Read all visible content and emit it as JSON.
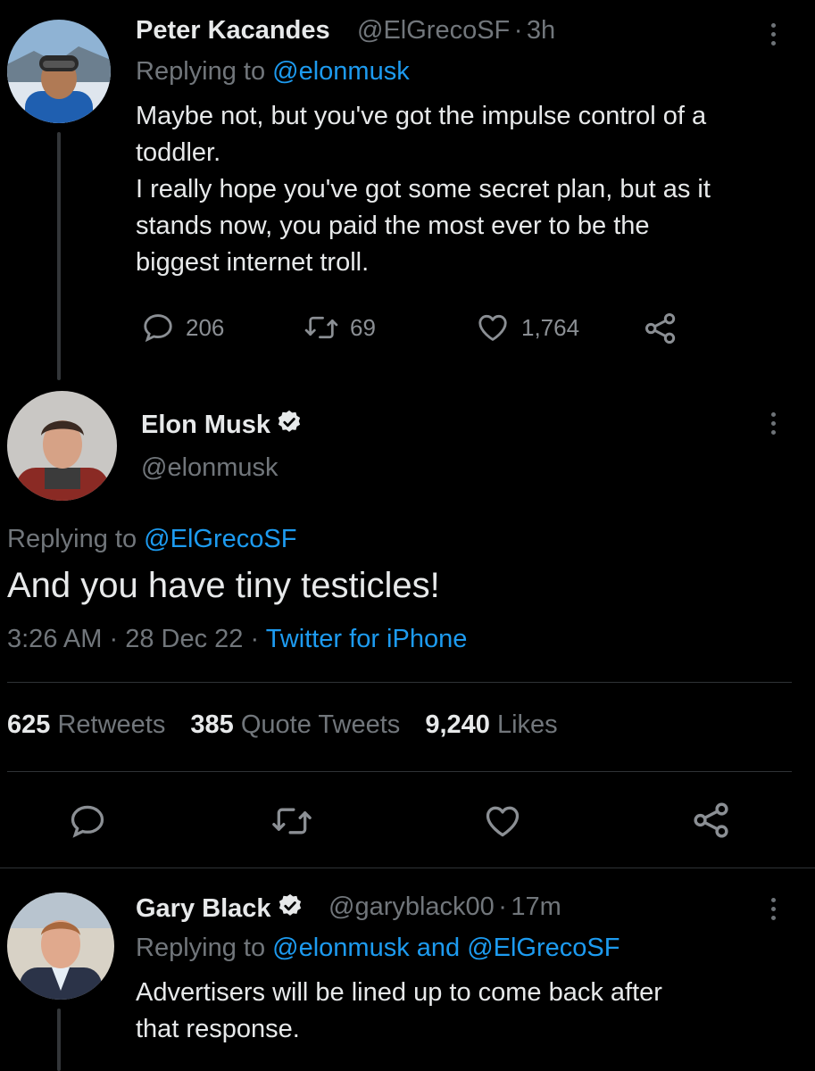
{
  "tweet1": {
    "name": "Peter Kacandes",
    "handle": "@ElGrecoSF",
    "separator": "·",
    "time": "3h",
    "reply_prefix": "Replying to",
    "reply_to": "@elonmusk",
    "text_line1": "Maybe not, but you've got the impulse control of a",
    "text_line2": "toddler.",
    "text_line3": "I really hope you've got some secret plan, but as it",
    "text_line4": "stands now, you paid the most ever to be the",
    "text_line5": "biggest internet troll.",
    "replies": "206",
    "retweets": "69",
    "likes": "1,764"
  },
  "main_tweet": {
    "name": "Elon Musk",
    "handle": "@elonmusk",
    "reply_prefix": "Replying to",
    "reply_to": "@ElGrecoSF",
    "text": "And you have tiny testicles!",
    "time": "3:26 AM",
    "separator": "·",
    "date": "28 Dec 22",
    "separator2": "·",
    "source": "Twitter for iPhone",
    "retweets_count": "625",
    "retweets_label": "Retweets",
    "quotes_count": "385",
    "quotes_label": "Quote Tweets",
    "likes_count": "9,240",
    "likes_label": "Likes"
  },
  "tweet3": {
    "name": "Gary Black",
    "handle": "@garyblack00",
    "separator": "·",
    "time": "17m",
    "reply_prefix": "Replying to",
    "reply_to": "@elonmusk and @ElGrecoSF",
    "text_line1": "Advertisers will be lined up to come back after",
    "text_line2": "that response."
  },
  "colors": {
    "background": "#000000",
    "text": "#e7e9ea",
    "muted": "#71767b",
    "accent": "#1d9bf0",
    "divider": "#2f3336"
  },
  "icons": {
    "reply": "reply-icon",
    "retweet": "retweet-icon",
    "like": "heart-icon",
    "share": "share-icon",
    "more": "more-vertical-icon",
    "verified": "verified-badge-icon"
  }
}
